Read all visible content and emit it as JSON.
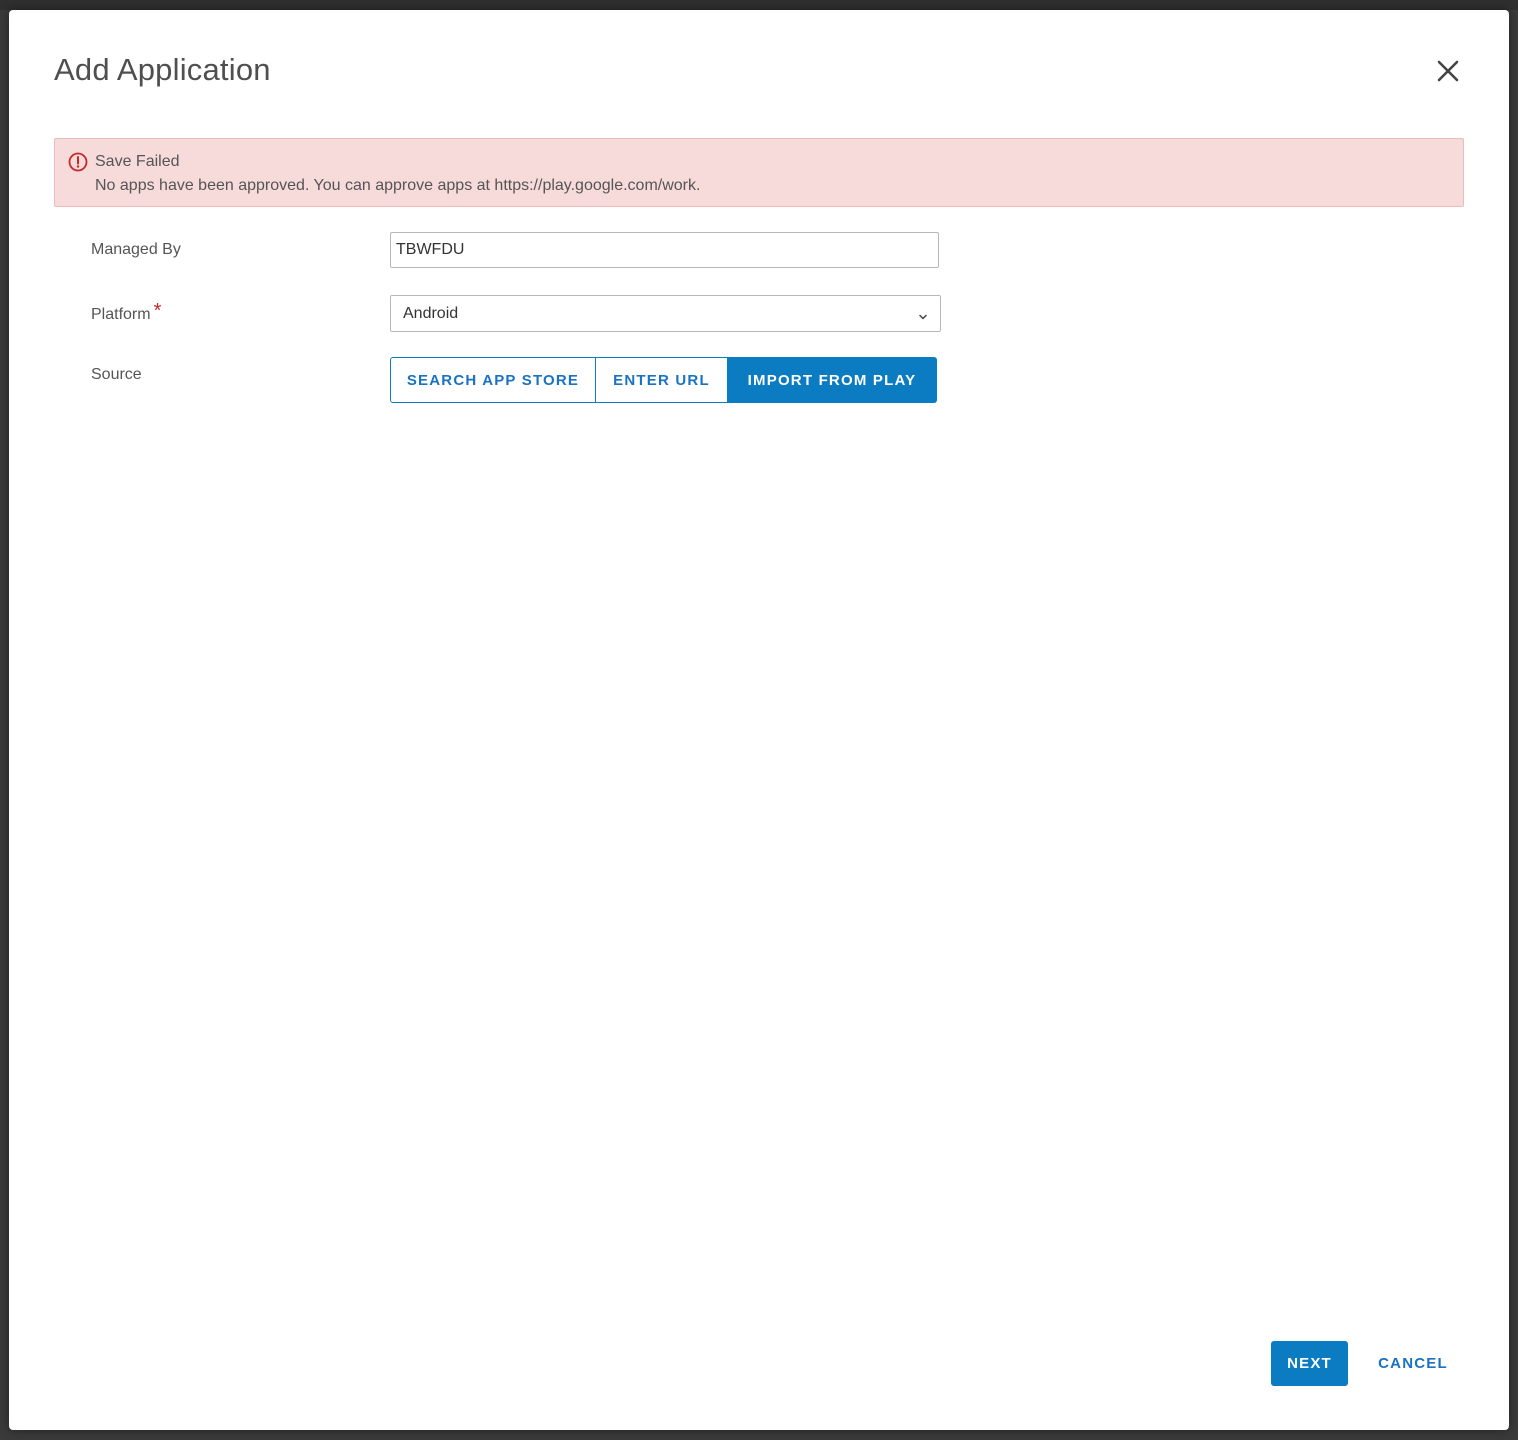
{
  "dialog": {
    "title": "Add Application",
    "close_icon": "close-icon"
  },
  "alert": {
    "icon": "error-circle-icon",
    "title": "Save Failed",
    "message": "No apps have been approved. You can approve apps at https://play.google.com/work."
  },
  "form": {
    "managed_by": {
      "label": "Managed By",
      "value": "TBWFDU"
    },
    "platform": {
      "label": "Platform",
      "required_marker": "*",
      "selected": "Android"
    },
    "source": {
      "label": "Source",
      "options": [
        "SEARCH APP STORE",
        "ENTER URL",
        "IMPORT FROM PLAY"
      ],
      "selected": "IMPORT FROM PLAY"
    }
  },
  "footer": {
    "next_label": "NEXT",
    "cancel_label": "CANCEL"
  },
  "colors": {
    "accent": "#0b7cc1",
    "error": "#c62828",
    "alert_bg": "#f7dada"
  }
}
